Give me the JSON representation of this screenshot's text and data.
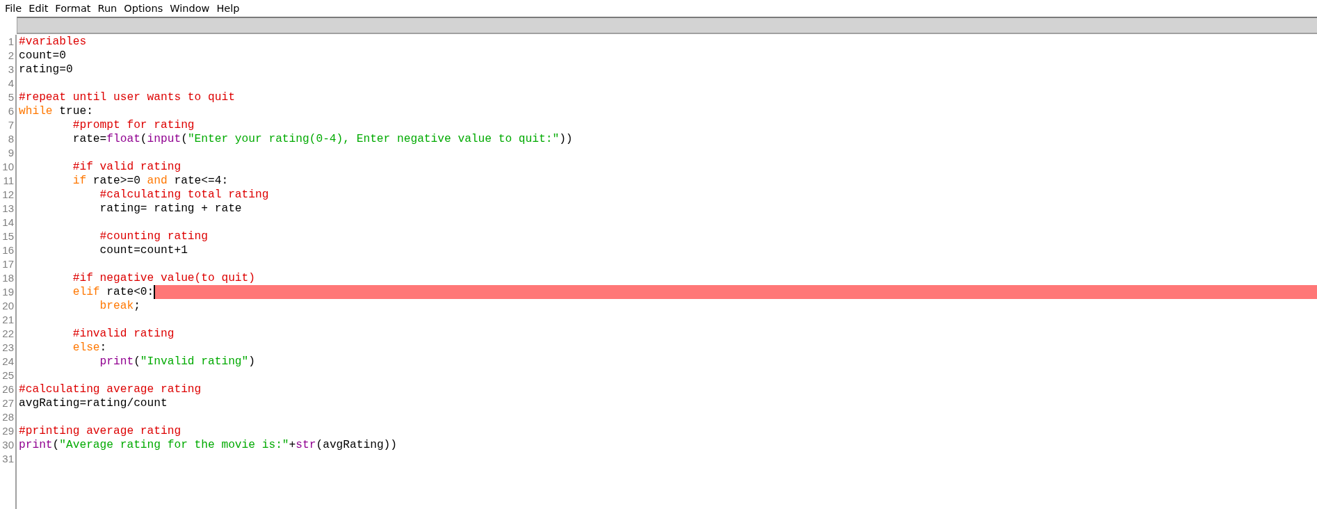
{
  "menu": [
    "File",
    "Edit",
    "Format",
    "Run",
    "Options",
    "Window",
    "Help"
  ],
  "lines": [
    {
      "number": "1",
      "tokens": [
        {
          "kind": "comment",
          "text": "#variables"
        }
      ]
    },
    {
      "number": "2",
      "tokens": [
        {
          "kind": "plain",
          "text": "count=0"
        }
      ]
    },
    {
      "number": "3",
      "tokens": [
        {
          "kind": "plain",
          "text": "rating=0"
        }
      ]
    },
    {
      "number": "4"
    },
    {
      "number": "5",
      "tokens": [
        {
          "kind": "comment",
          "text": "#repeat until user wants to quit"
        }
      ]
    },
    {
      "number": "6",
      "tokens": [
        {
          "kind": "keyword",
          "text": "while"
        },
        {
          "kind": "plain",
          "text": " true:"
        }
      ],
      "children": [
        {
          "number": "7",
          "tokens": [
            {
              "kind": "comment",
              "text": "#prompt for rating"
            }
          ]
        },
        {
          "number": "8",
          "tokens": [
            {
              "kind": "plain",
              "text": "rate="
            },
            {
              "kind": "builtin",
              "text": "float"
            },
            {
              "kind": "plain",
              "text": "("
            },
            {
              "kind": "builtin",
              "text": "input"
            },
            {
              "kind": "plain",
              "text": "("
            },
            {
              "kind": "string",
              "text": "\"Enter your rating(0-4), Enter negative value to quit:\""
            },
            {
              "kind": "plain",
              "text": "))"
            }
          ]
        },
        {
          "number": "9"
        },
        {
          "number": "10",
          "tokens": [
            {
              "kind": "comment",
              "text": "#if valid rating"
            }
          ]
        },
        {
          "number": "11",
          "tokens": [
            {
              "kind": "keyword",
              "text": "if"
            },
            {
              "kind": "plain",
              "text": " rate>=0 "
            },
            {
              "kind": "keyword",
              "text": "and"
            },
            {
              "kind": "plain",
              "text": " rate<=4:"
            }
          ],
          "children": [
            {
              "number": "12",
              "tokens": [
                {
                  "kind": "comment",
                  "text": "#calculating total rating"
                }
              ]
            },
            {
              "number": "13",
              "tokens": [
                {
                  "kind": "plain",
                  "text": "rating= rating + rate"
                }
              ]
            },
            {
              "number": "14"
            },
            {
              "number": "15",
              "tokens": [
                {
                  "kind": "comment",
                  "text": "#counting rating"
                }
              ]
            },
            {
              "number": "16",
              "tokens": [
                {
                  "kind": "plain",
                  "text": "count=count+1"
                }
              ]
            }
          ]
        },
        {
          "number": "17"
        },
        {
          "number": "18",
          "tokens": [
            {
              "kind": "comment",
              "text": "#if negative value(to quit)"
            }
          ]
        },
        {
          "number": "19",
          "error": true,
          "cursor": true,
          "tokens": [
            {
              "kind": "keyword",
              "text": "elif"
            },
            {
              "kind": "plain",
              "text": " rate<0:"
            }
          ],
          "children": [
            {
              "number": "20",
              "tokens": [
                {
                  "kind": "keyword",
                  "text": "break"
                },
                {
                  "kind": "plain",
                  "text": ";"
                }
              ]
            }
          ]
        },
        {
          "number": "21"
        },
        {
          "number": "22",
          "tokens": [
            {
              "kind": "comment",
              "text": "#invalid rating"
            }
          ]
        },
        {
          "number": "23",
          "tokens": [
            {
              "kind": "keyword",
              "text": "else"
            },
            {
              "kind": "plain",
              "text": ":"
            }
          ],
          "children": [
            {
              "number": "24",
              "tokens": [
                {
                  "kind": "builtin",
                  "text": "print"
                },
                {
                  "kind": "plain",
                  "text": "("
                },
                {
                  "kind": "string",
                  "text": "\"Invalid rating\""
                },
                {
                  "kind": "plain",
                  "text": ")"
                }
              ]
            }
          ]
        }
      ]
    },
    {
      "number": "25"
    },
    {
      "number": "26",
      "tokens": [
        {
          "kind": "comment",
          "text": "#calculating average rating"
        }
      ]
    },
    {
      "number": "27",
      "tokens": [
        {
          "kind": "plain",
          "text": "avgRating=rating/count"
        }
      ]
    },
    {
      "number": "28"
    },
    {
      "number": "29",
      "tokens": [
        {
          "kind": "comment",
          "text": "#printing average rating"
        }
      ]
    },
    {
      "number": "30",
      "tokens": [
        {
          "kind": "builtin",
          "text": "print"
        },
        {
          "kind": "plain",
          "text": "("
        },
        {
          "kind": "string",
          "text": "\"Average rating for the movie is:\""
        },
        {
          "kind": "plain",
          "text": "+"
        },
        {
          "kind": "builtin",
          "text": "str"
        },
        {
          "kind": "plain",
          "text": "(avgRating))"
        }
      ]
    },
    {
      "number": "31"
    }
  ]
}
